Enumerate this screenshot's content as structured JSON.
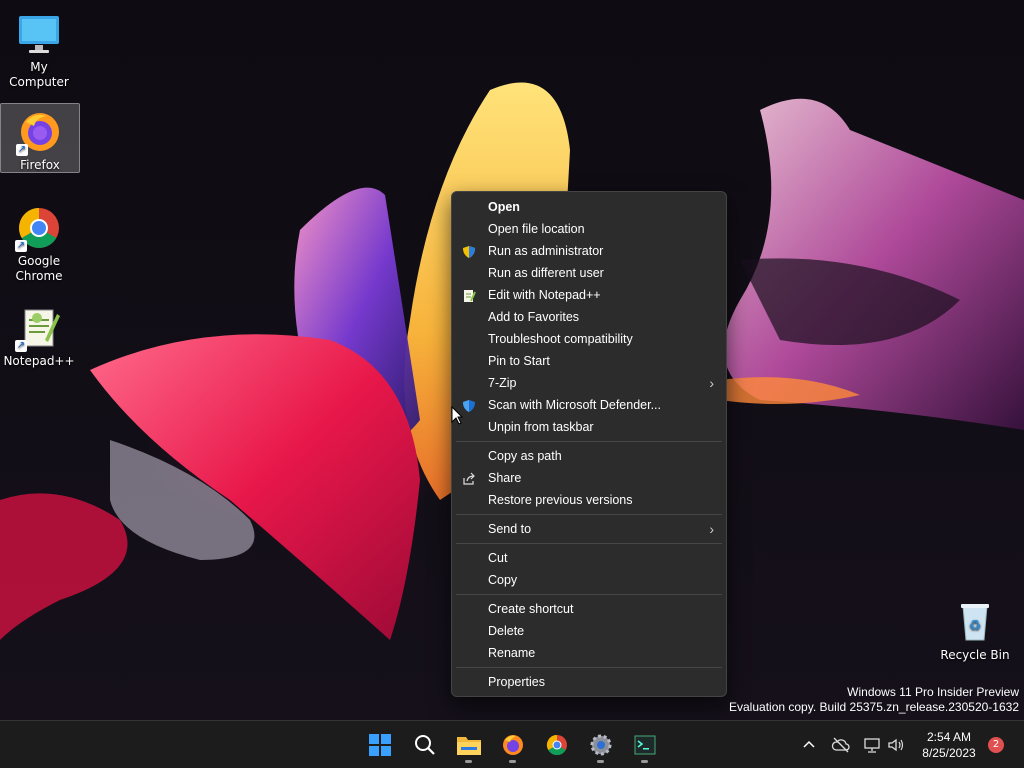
{
  "desktop": {
    "icons": [
      {
        "label": "My Computer",
        "icon": "monitor-icon"
      },
      {
        "label": "Firefox",
        "icon": "firefox-icon"
      },
      {
        "label": "Google Chrome",
        "icon": "chrome-icon"
      },
      {
        "label": "Notepad++",
        "icon": "notepadpp-icon"
      },
      {
        "label": "Recycle Bin",
        "icon": "recycle-bin-icon"
      }
    ]
  },
  "context_menu": {
    "groups": [
      [
        {
          "label": "Open",
          "bold": true
        },
        {
          "label": "Open file location"
        },
        {
          "label": "Run as administrator",
          "icon": "uac-shield-icon"
        },
        {
          "label": "Run as different user"
        },
        {
          "label": "Edit with Notepad++",
          "icon": "notepadpp-icon"
        },
        {
          "label": "Add to Favorites"
        },
        {
          "label": "Troubleshoot compatibility"
        },
        {
          "label": "Pin to Start"
        },
        {
          "label": "7-Zip",
          "submenu": true
        },
        {
          "label": "Scan with Microsoft Defender...",
          "icon": "defender-icon"
        },
        {
          "label": "Unpin from taskbar"
        }
      ],
      [
        {
          "label": "Copy as path"
        },
        {
          "label": "Share",
          "icon": "share-icon"
        },
        {
          "label": "Restore previous versions"
        }
      ],
      [
        {
          "label": "Send to",
          "submenu": true
        }
      ],
      [
        {
          "label": "Cut"
        },
        {
          "label": "Copy"
        }
      ],
      [
        {
          "label": "Create shortcut"
        },
        {
          "label": "Delete"
        },
        {
          "label": "Rename"
        }
      ],
      [
        {
          "label": "Properties"
        }
      ]
    ]
  },
  "watermark": {
    "line1": "Windows 11 Pro Insider Preview",
    "line2": "Evaluation copy. Build 25375.zn_release.230520-1632"
  },
  "taskbar": {
    "apps": [
      "start-icon",
      "search-icon",
      "file-explorer-icon",
      "firefox-icon",
      "chrome-icon",
      "settings-icon",
      "terminal-icon"
    ],
    "clock": {
      "time": "2:54 AM",
      "date": "8/25/2023"
    },
    "notification_count": "2"
  },
  "colors": {
    "menu_bg": "#2c2c2c",
    "taskbar_bg": "#1c1c1c",
    "accent": "#0078d4"
  }
}
